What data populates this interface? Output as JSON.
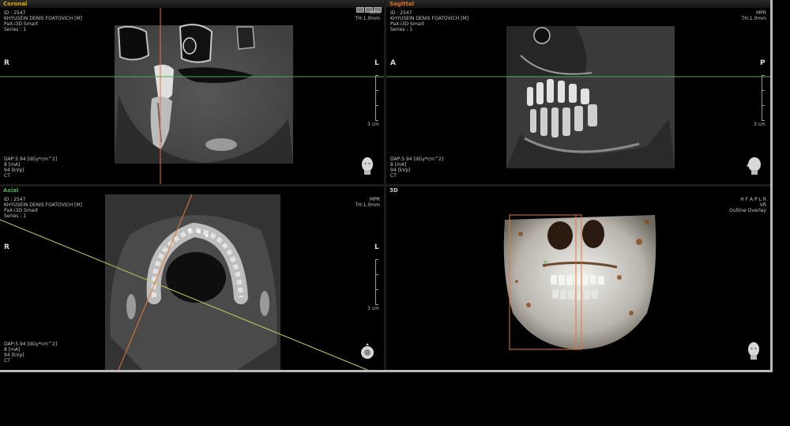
{
  "patient": {
    "id_line": "ID : 2547",
    "name_line": "KHYUSEIN DENIS FOATOVICH [M]",
    "device_line": "PaX-i3D Smart",
    "series_line": "Series : 1"
  },
  "settings": {
    "mode": "MPR",
    "thickness": "TH:1.0mm",
    "dap": "DAP:5.94 [dGy*cm^2]",
    "ma": "8 [mA]",
    "kvp": "94 [kVp]",
    "modality": "CT",
    "scale": "3 cm"
  },
  "panels": {
    "coronal": {
      "title": "Coronal",
      "left": "R",
      "right": "L",
      "title_color": "#e0b000"
    },
    "sagittal": {
      "title": "Sagittal",
      "left": "A",
      "right": "P",
      "title_color": "#e07020"
    },
    "axial": {
      "title": "Axial",
      "left": "R",
      "right": "L",
      "title_color": "#4fb04f"
    },
    "three_d": {
      "title": "3D",
      "orientation": "H F A P L R",
      "mode": "VR",
      "overlay": "Outline Overlay",
      "title_color": "#cfcfcf"
    }
  },
  "colors": {
    "coronal_line": "#e07a3a",
    "axial_line": "#4fa84f",
    "sagittal_line": "#c8c860"
  }
}
